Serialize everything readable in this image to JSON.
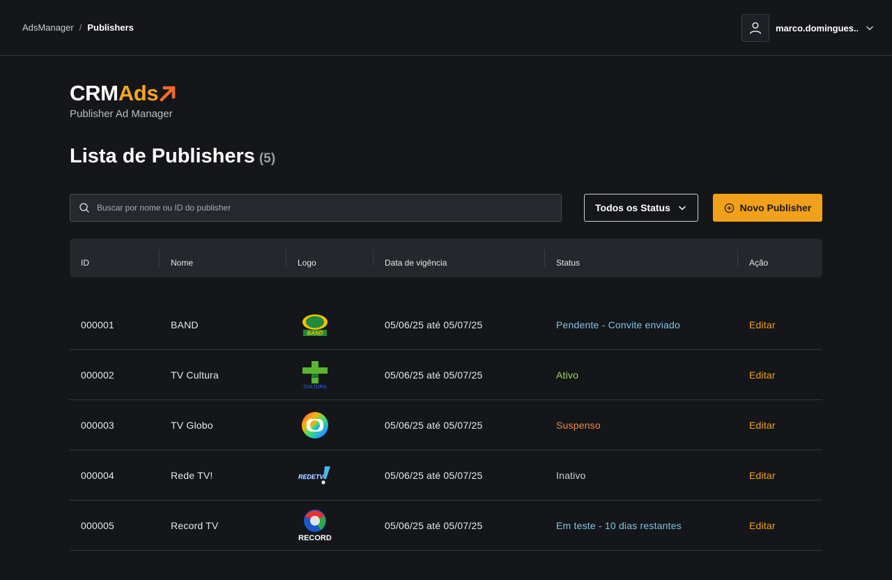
{
  "breadcrumb": {
    "root": "AdsManager",
    "separator": "/",
    "current": "Publishers"
  },
  "user": {
    "name": "marco.domingues..."
  },
  "brand": {
    "name_part1": "CRM",
    "name_part2": "Ads",
    "subtitle": "Publisher Ad Manager",
    "accent": "#f5a623"
  },
  "page": {
    "title": "Lista de Publishers",
    "count": "(5)"
  },
  "search": {
    "placeholder": "Buscar por nome ou ID do publisher",
    "value": ""
  },
  "filter": {
    "selected": "Todos os Status"
  },
  "new_button": {
    "label": "Novo Publisher"
  },
  "table": {
    "columns": [
      "ID",
      "Nome",
      "Logo",
      "Data de vigência",
      "Status",
      "Ação"
    ],
    "rows": [
      {
        "id": "000001",
        "name": "BAND",
        "logo": "band-logo",
        "date": "05/06/25 até 05/07/25",
        "status": "Pendente - Convite enviado",
        "status_color": "#7fc4e8",
        "action": "Editar"
      },
      {
        "id": "000002",
        "name": "TV Cultura",
        "logo": "cultura-logo",
        "date": "05/06/25 até 05/07/25",
        "status": "Ativo",
        "status_color": "#9fd66b",
        "action": "Editar"
      },
      {
        "id": "000003",
        "name": "TV Globo",
        "logo": "globo-logo",
        "date": "05/06/25 até 05/07/25",
        "status": "Suspenso",
        "status_color": "#f08a4b",
        "action": "Editar"
      },
      {
        "id": "000004",
        "name": "Rede TV!",
        "logo": "redetv-logo",
        "date": "05/06/25 até 05/07/25",
        "status": "Inativo",
        "status_color": "#c9ccd1",
        "action": "Editar"
      },
      {
        "id": "000005",
        "name": "Record TV",
        "logo": "record-logo",
        "date": "05/06/25 até 05/07/25",
        "status": "Em teste - 10 dias restantes",
        "status_color": "#7fc4e8",
        "action": "Editar"
      }
    ]
  }
}
